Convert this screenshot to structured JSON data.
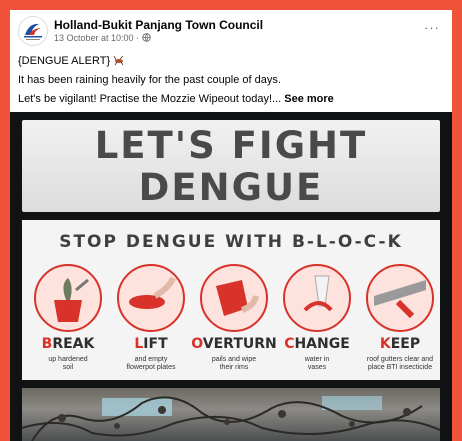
{
  "post": {
    "page_name": "Holland-Bukit Panjang Town Council",
    "timestamp": "13 October at 10:00 ·",
    "lines": [
      "{DENGUE ALERT}",
      "It has been raining heavily for the past couple of days.",
      "Let's be vigilant! Practise the Mozzie Wipeout today!..."
    ],
    "see_more": "See more",
    "more_icon": "···"
  },
  "image": {
    "headline_1": "LET'S FIGHT",
    "headline_2": "DENGUE",
    "subtitle": "STOP DENGUE WITH B-L-O-C-K",
    "steps": [
      {
        "first": "B",
        "rest": "REAK",
        "desc_1": "up hardened",
        "desc_2": "soil"
      },
      {
        "first": "L",
        "rest": "IFT",
        "desc_1": "and empty",
        "desc_2": "flowerpot plates"
      },
      {
        "first": "O",
        "rest": "VERTURN",
        "desc_1": "pails and wipe",
        "desc_2": "their rims"
      },
      {
        "first": "C",
        "rest": "HANGE",
        "desc_1": "water in",
        "desc_2": "vases"
      },
      {
        "first": "K",
        "rest": "EEP",
        "desc_1": "roof gutters clear and",
        "desc_2": "place BTI insecticide"
      }
    ]
  },
  "colors": {
    "frame": "#f0533a",
    "accent_red": "#d8322a",
    "text": "#050505",
    "meta": "#65676b"
  }
}
